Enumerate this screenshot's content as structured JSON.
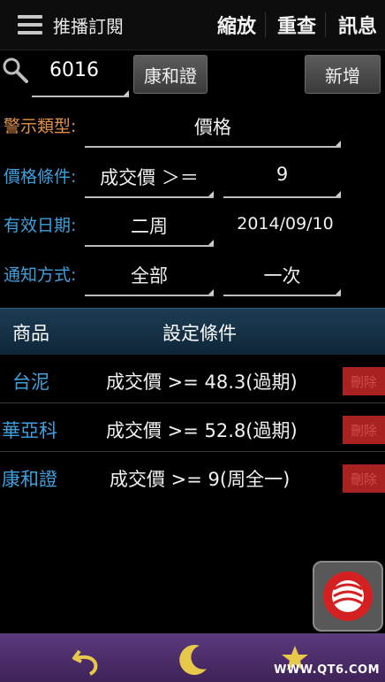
{
  "app": {
    "title": "推播訂閱"
  },
  "topbar": {
    "actions": [
      "縮放",
      "重查",
      "訊息"
    ]
  },
  "search": {
    "value": "6016",
    "stock_name_button": "康和證",
    "add_button": "新增"
  },
  "form": {
    "alert_type": {
      "label": "警示類型:",
      "value": "價格"
    },
    "price_condition": {
      "label": "價格條件:",
      "operator": "成交價 ＞＝",
      "value": "9"
    },
    "valid_date": {
      "label": "有效日期:",
      "period": "二周",
      "date": "2014/09/10"
    },
    "notify": {
      "label": "通知方式:",
      "method": "全部",
      "frequency": "一次"
    }
  },
  "table": {
    "headers": [
      "商品",
      "設定條件"
    ],
    "rows": [
      {
        "product": "台泥",
        "condition": "成交價 >= 48.3(過期)",
        "delete": "刪除"
      },
      {
        "product": "華亞科",
        "condition": "成交價 >= 52.8(過期)",
        "delete": "刪除"
      },
      {
        "product": "康和證",
        "condition": "成交價 >= 9(周全一)",
        "delete": "刪除"
      }
    ]
  },
  "footer": {
    "watermark": "WWW.QT6.COM"
  },
  "colors": {
    "label_orange": "#e3924a",
    "label_blue": "#3fa0dd",
    "table_header": "#16324a",
    "bottom_bar": "#4e2d6e",
    "delete_red": "#a82222"
  }
}
